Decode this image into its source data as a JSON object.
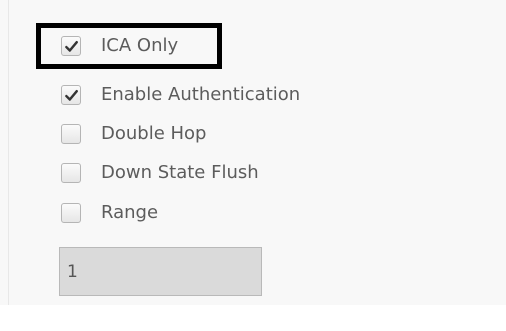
{
  "options": [
    {
      "label": "ICA Only",
      "checked": true
    },
    {
      "label": "Enable Authentication",
      "checked": true
    },
    {
      "label": "Double Hop",
      "checked": false
    },
    {
      "label": "Down State Flush",
      "checked": false
    },
    {
      "label": "Range",
      "checked": false
    }
  ],
  "range_input": {
    "value": "1"
  },
  "colors": {
    "highlight_border": "#000000",
    "checkmark": "#333333",
    "label_text": "#5c5c5c",
    "input_background": "#dadada"
  }
}
